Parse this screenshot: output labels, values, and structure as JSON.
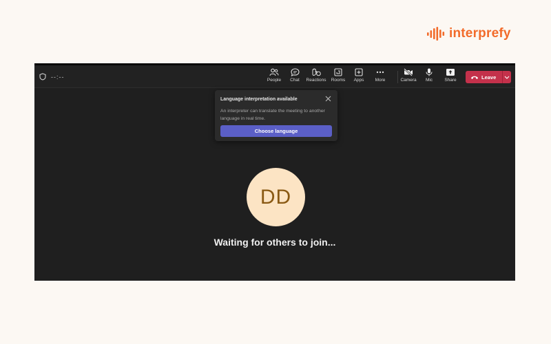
{
  "brand": {
    "name": "interprefy",
    "color": "#f26b2a"
  },
  "meeting": {
    "timer": "--:--",
    "toolbar": [
      {
        "id": "people",
        "label": "People",
        "icon": "people-icon"
      },
      {
        "id": "chat",
        "label": "Chat",
        "icon": "chat-icon"
      },
      {
        "id": "reactions",
        "label": "Reactions",
        "icon": "reactions-icon"
      },
      {
        "id": "rooms",
        "label": "Rooms",
        "icon": "rooms-icon"
      },
      {
        "id": "apps",
        "label": "Apps",
        "icon": "apps-icon"
      },
      {
        "id": "more",
        "label": "More",
        "icon": "more-icon"
      },
      {
        "id": "camera",
        "label": "Camera",
        "icon": "camera-off-icon"
      },
      {
        "id": "mic",
        "label": "Mic",
        "icon": "mic-icon"
      },
      {
        "id": "share",
        "label": "Share",
        "icon": "share-icon"
      }
    ],
    "leave": {
      "label": "Leave",
      "color": "#c4314b"
    }
  },
  "popup": {
    "title": "Language interpretation available",
    "description": "An interpreter can translate the meeting to another language in real time.",
    "button": "Choose language",
    "button_color": "#5b5fc7"
  },
  "stage": {
    "avatar_initials": "DD",
    "status": "Waiting for others to join..."
  }
}
